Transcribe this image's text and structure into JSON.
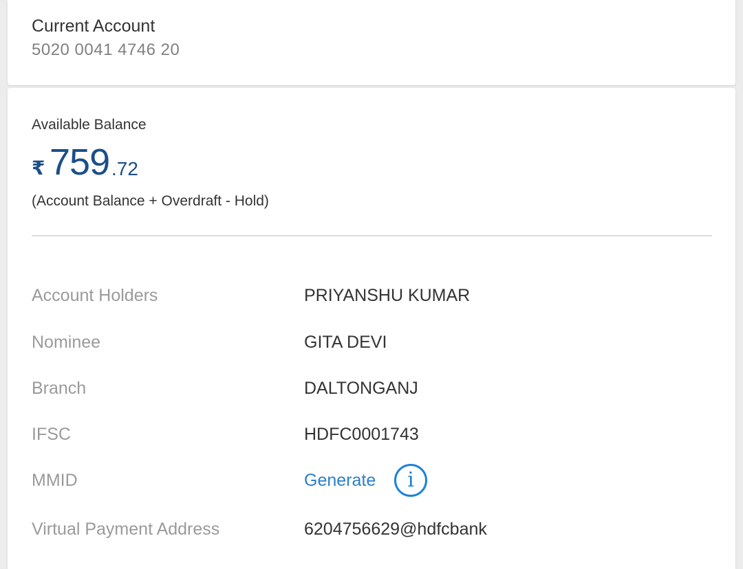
{
  "account": {
    "type": "Current Account",
    "number": "5020 0041 4746 20"
  },
  "balance": {
    "label": "Available Balance",
    "currency_symbol": "₹",
    "integer": "759",
    "decimal": ".72",
    "note": "(Account Balance + Overdraft - Hold)"
  },
  "details": {
    "holders_label": "Account Holders",
    "holders_value": "PRIYANSHU KUMAR",
    "nominee_label": "Nominee",
    "nominee_value": "GITA DEVI",
    "branch_label": "Branch",
    "branch_value": "DALTONGANJ",
    "ifsc_label": "IFSC",
    "ifsc_value": "HDFC0001743",
    "mmid_label": "MMID",
    "mmid_action": "Generate",
    "mmid_info_glyph": "i",
    "vpa_label": "Virtual Payment Address",
    "vpa_value": "6204756629@hdfcbank"
  },
  "colors": {
    "balance": "#1b4f87",
    "link": "#2a7fc9",
    "info_icon": "#1b82d8",
    "label": "#9a9a9a",
    "value": "#333333"
  }
}
